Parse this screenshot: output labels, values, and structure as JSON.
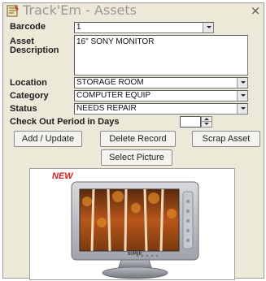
{
  "window": {
    "title": "Track'Em - Assets",
    "close_glyph": "×"
  },
  "form": {
    "barcode": {
      "label": "Barcode",
      "value": "1"
    },
    "description": {
      "label_line1": "Asset",
      "label_line2": "Description",
      "value": "16\" SONY MONITOR"
    },
    "location": {
      "label": "Location",
      "value": "STORAGE ROOM"
    },
    "category": {
      "label": "Category",
      "value": "COMPUTER EQUIP"
    },
    "status": {
      "label": "Status",
      "value": "NEEDS REPAIR"
    },
    "checkout": {
      "label": "Check Out Period in Days",
      "value": ""
    }
  },
  "buttons": {
    "add_update": "Add / Update",
    "delete_record": "Delete Record",
    "scrap_asset": "Scrap Asset",
    "select_picture": "Select Picture"
  },
  "picture": {
    "badge": "NEW",
    "brand_top": "",
    "brand_bottom": "SUPER"
  },
  "colors": {
    "window_bg": "#ece9d8",
    "title_text": "#999999",
    "badge_red": "#d41f1f"
  },
  "icons": {
    "app": "app-notepad-icon",
    "close": "close-icon",
    "dropdown": "chevron-down-icon"
  }
}
